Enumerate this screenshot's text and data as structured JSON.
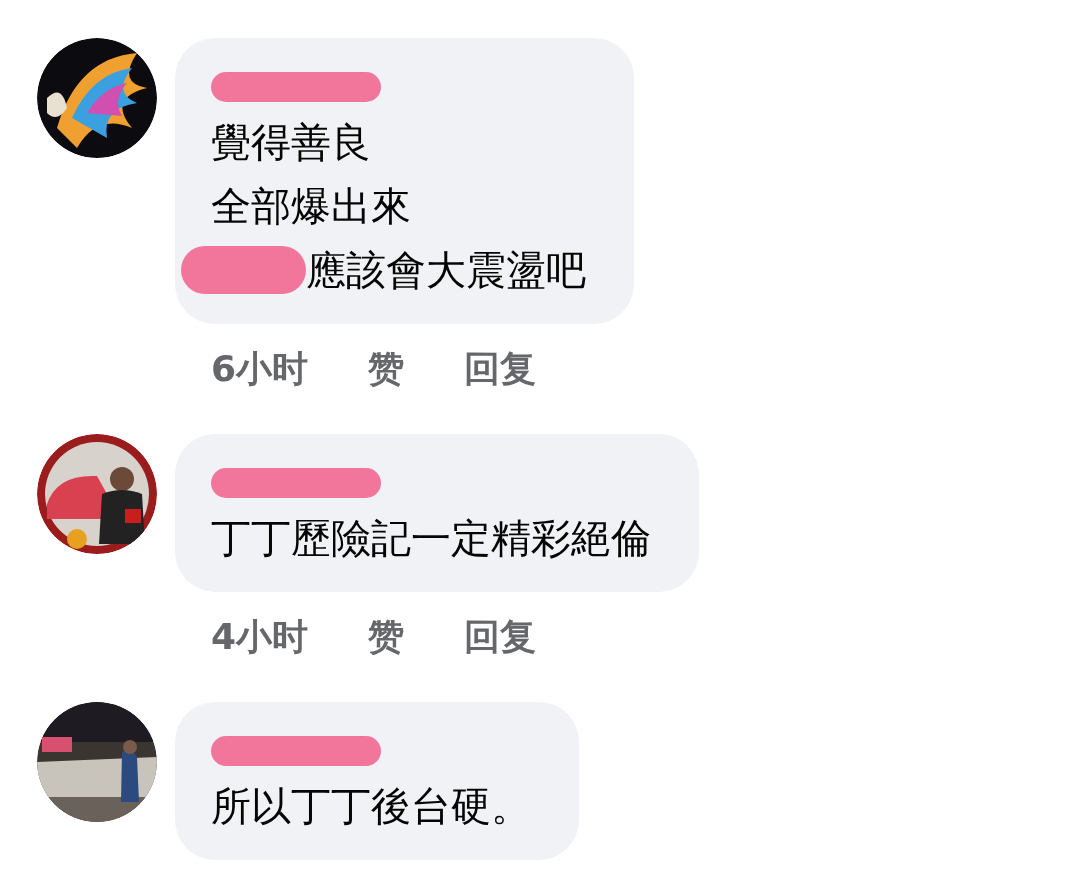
{
  "comments": [
    {
      "name_redacted": true,
      "lines": [
        {
          "text": "覺得善良",
          "redacted_prefix": false
        },
        {
          "text": "全部爆出來",
          "redacted_prefix": false
        },
        {
          "text": "應該會大震盪吧",
          "redacted_prefix": true
        }
      ],
      "time": "6小时",
      "like": "赞",
      "reply": "回复"
    },
    {
      "name_redacted": true,
      "lines": [
        {
          "text": "丁丁歷險記一定精彩絕倫",
          "redacted_prefix": false
        }
      ],
      "time": "4小时",
      "like": "赞",
      "reply": "回复"
    },
    {
      "name_redacted": true,
      "lines": [
        {
          "text": "所以丁丁後台硬。",
          "redacted_prefix": false
        }
      ]
    }
  ]
}
